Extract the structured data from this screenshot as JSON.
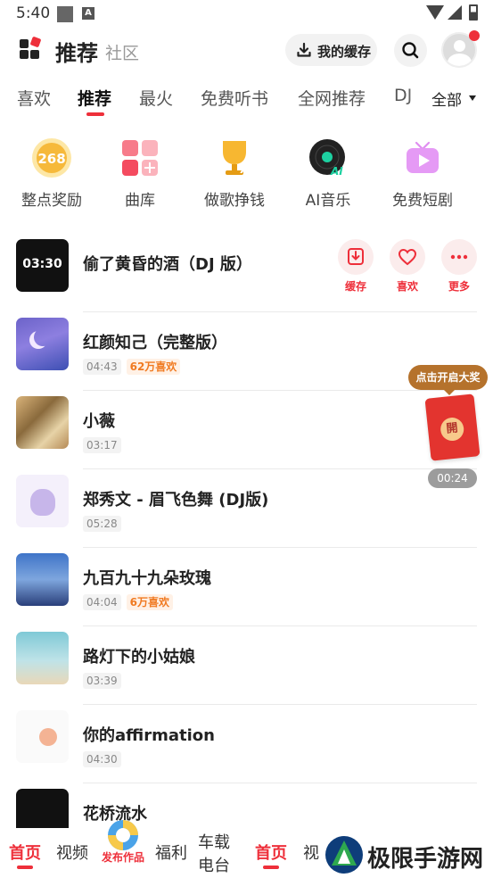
{
  "status_bar": {
    "time": "5:40"
  },
  "header": {
    "title": "推荐",
    "subtitle": "社区",
    "cache_label": "我的缓存"
  },
  "tabs": [
    {
      "label": "喜欢",
      "active": false
    },
    {
      "label": "推荐",
      "active": true
    },
    {
      "label": "最火",
      "active": false
    },
    {
      "label": "免费听书",
      "active": false
    },
    {
      "label": "全网推荐",
      "active": false
    },
    {
      "label": "DJ",
      "active": false
    }
  ],
  "tabs_all": "全部",
  "shortcuts": [
    {
      "label": "整点奖励",
      "icon": "coin-268-icon",
      "badge": "268"
    },
    {
      "label": "曲库",
      "icon": "music-library-icon"
    },
    {
      "label": "做歌挣钱",
      "icon": "ai-trophy-icon"
    },
    {
      "label": "AI音乐",
      "icon": "ai-vinyl-icon"
    },
    {
      "label": "免费短剧",
      "icon": "tv-play-icon"
    }
  ],
  "songs": [
    {
      "title": "偷了黄昏的酒（DJ 版）",
      "cover_duration": "03:30"
    },
    {
      "title": "红颜知己（完整版）",
      "duration": "04:43",
      "likes": "62万喜欢"
    },
    {
      "title": "小薇",
      "duration": "03:17"
    },
    {
      "title": "郑秀文 - 眉飞色舞 (DJ版)",
      "duration": "05:28"
    },
    {
      "title": "九百九十九朵玫瑰",
      "duration": "04:04",
      "likes": "6万喜欢"
    },
    {
      "title": "路灯下的小姑娘",
      "duration": "03:39"
    },
    {
      "title": "你的affirmation",
      "duration": "04:30"
    },
    {
      "title": "花桥流水"
    }
  ],
  "song_actions": {
    "cache": "缓存",
    "like": "喜欢",
    "more": "更多"
  },
  "prize": {
    "tip": "点击开启大奖",
    "seal": "開",
    "timer": "00:24"
  },
  "bottom_nav": {
    "home": "首页",
    "video": "视频",
    "publish": "发布作品",
    "welfare": "福利",
    "car_line1": "车载",
    "car_line2": "电台",
    "home2": "首页",
    "video2_partial": "视"
  },
  "watermark": {
    "text": "极限手游网"
  },
  "colors": {
    "accent": "#ee2f3a",
    "orange": "#f07a21",
    "prize_brown": "#b5722c"
  }
}
